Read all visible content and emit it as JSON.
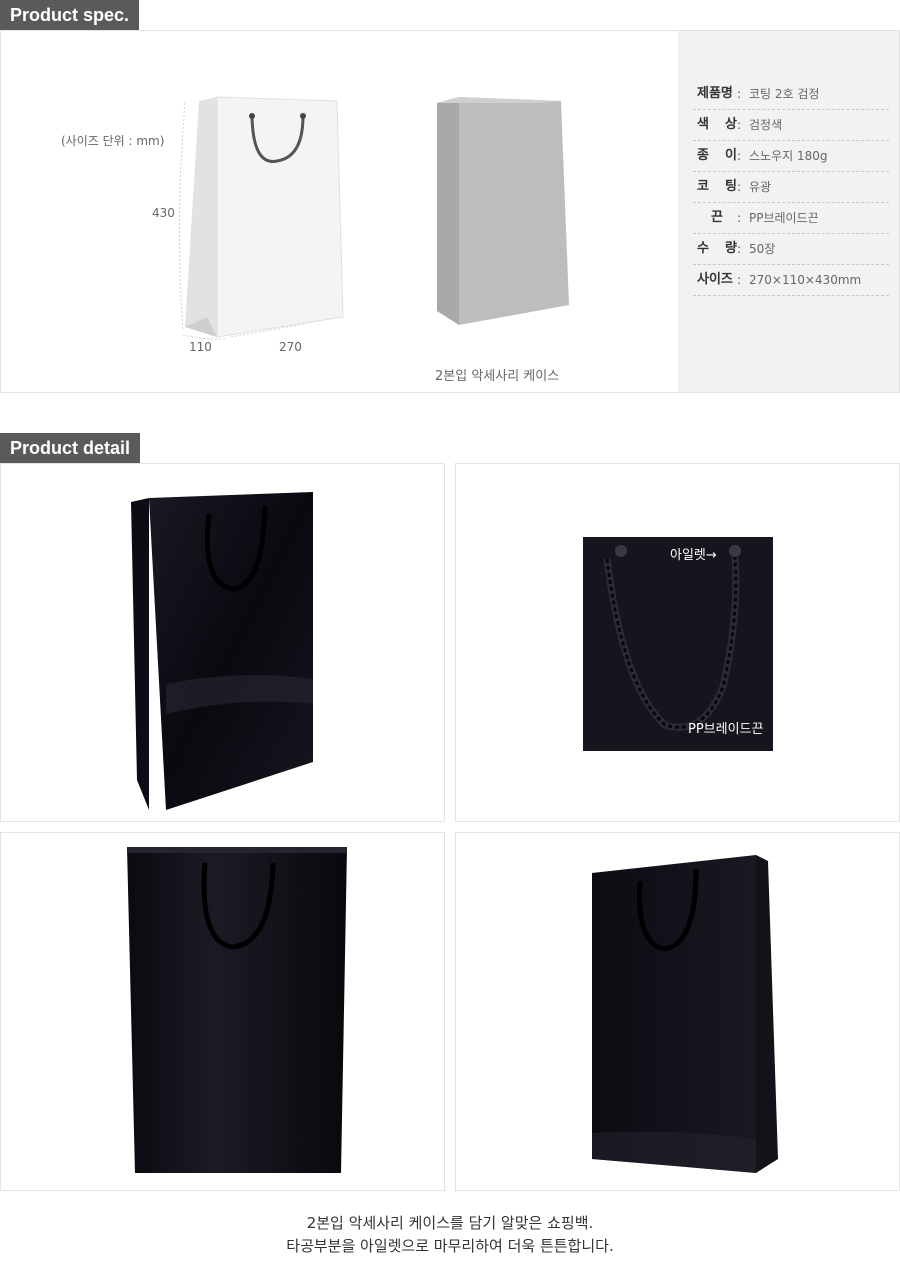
{
  "spec_section": {
    "title": "Product spec.",
    "unit_note": "(사이즈 단위 : mm)",
    "dimensions": {
      "height": "430",
      "depth": "110",
      "width": "270"
    },
    "case_caption": "2본입 악세사리 케이스",
    "rows": [
      {
        "label": "제품명",
        "value": "코팅 2호 검정"
      },
      {
        "label": "색 상",
        "value": "검정색"
      },
      {
        "label": "종 이",
        "value": "스노우지 180g"
      },
      {
        "label": "코 팅",
        "value": "유광"
      },
      {
        "label": "끈",
        "value": "PP브레이드끈"
      },
      {
        "label": "수 량",
        "value": "50장"
      },
      {
        "label": "사이즈",
        "value": "270×110×430mm"
      }
    ]
  },
  "detail_section": {
    "title": "Product detail",
    "closeup_labels": {
      "eyelet": "아일렛→",
      "handle": "PP브레이드끈"
    }
  },
  "footer": {
    "line1": "2본입 악세사리 케이스를 담기 알맞은 쇼핑백.",
    "line2": "타공부분을 아일렛으로 마무리하여 더욱 튼튼합니다."
  },
  "colors": {
    "tab_bg": "#5a5a5a",
    "bag_black": "#0c0b12",
    "panel_gray": "#f2f2f2"
  }
}
